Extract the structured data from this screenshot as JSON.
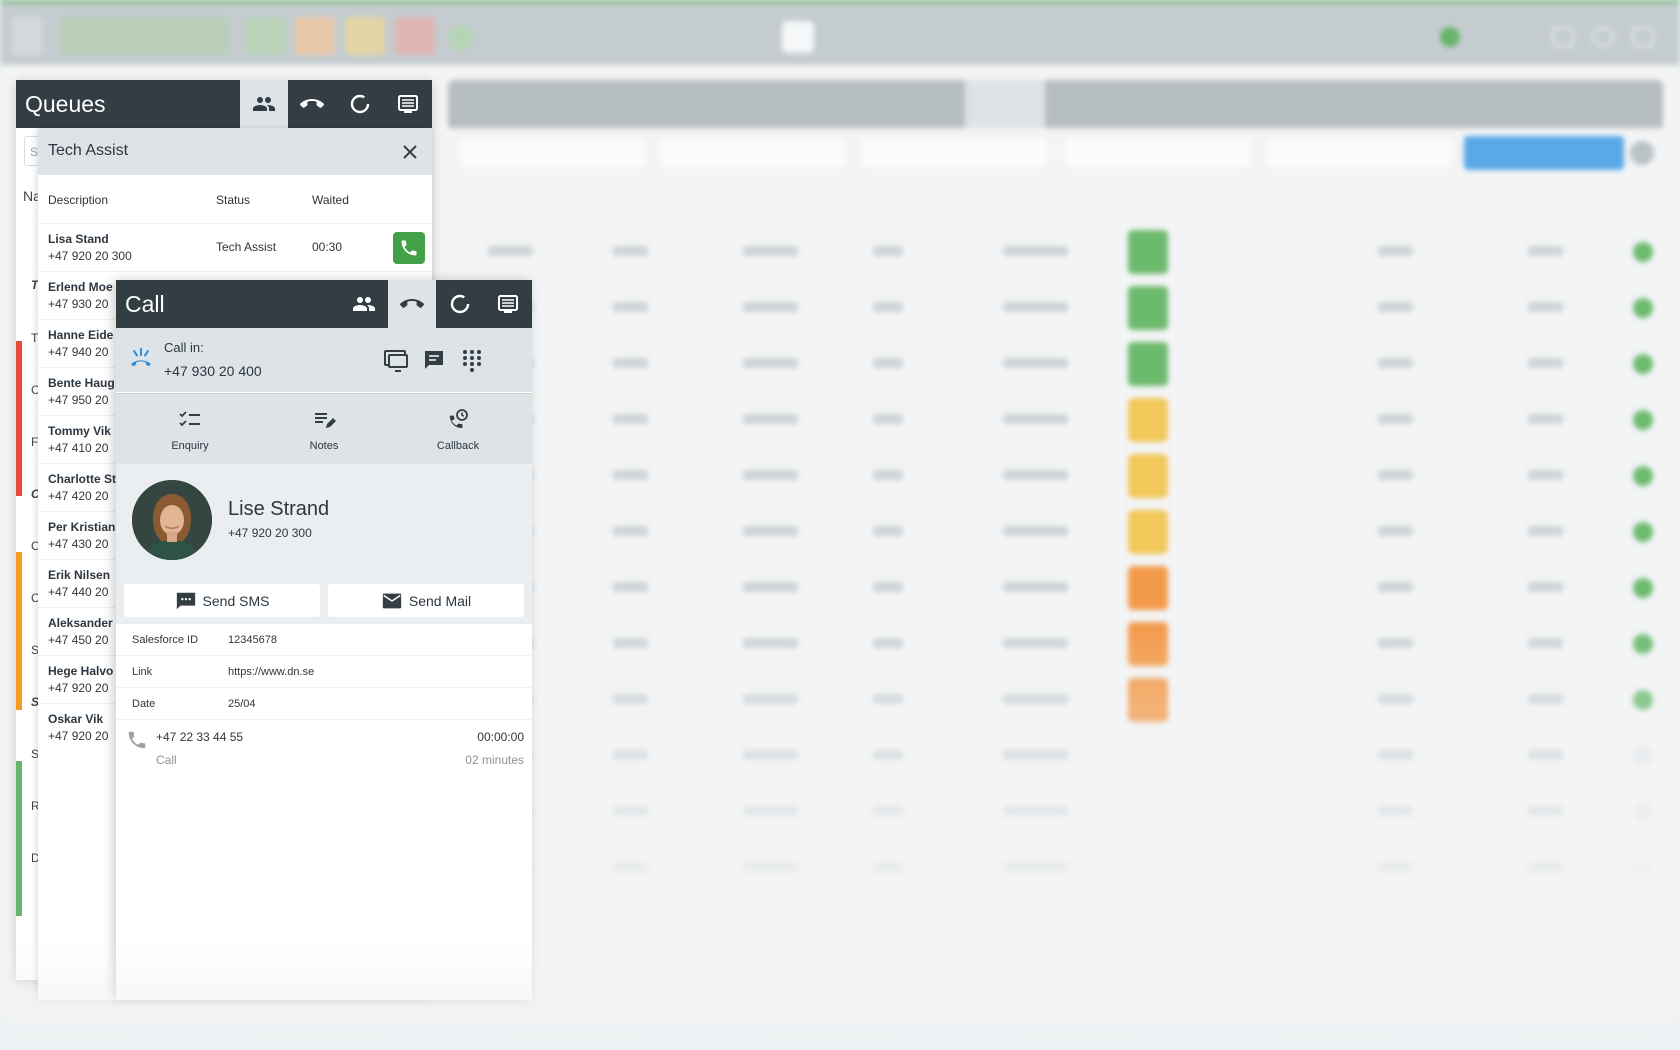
{
  "queues": {
    "title": "Queues",
    "search_placeholder": "S",
    "column_letter": "Na",
    "group_letters": [
      "T",
      "T",
      "C",
      "F",
      "C",
      "C",
      "C",
      "S",
      "S",
      "S",
      "R",
      "D"
    ]
  },
  "tech_assist": {
    "title": "Tech Assist",
    "columns": {
      "description": "Description",
      "status": "Status",
      "waited": "Waited"
    },
    "rows": [
      {
        "name": "Lisa Stand",
        "phone": "+47 920 20 300",
        "status": "Tech Assist",
        "waited": "00:30"
      },
      {
        "name": "Erlend Moe",
        "phone": "+47 930 20"
      },
      {
        "name": "Hanne Eide",
        "phone": "+47 940 20"
      },
      {
        "name": "Bente Haug",
        "phone": "+47 950 20"
      },
      {
        "name": "Tommy Vik",
        "phone": "+47 410 20"
      },
      {
        "name": "Charlotte St",
        "phone": "+47 420 20"
      },
      {
        "name": "Per Kristian",
        "phone": "+47 430 20"
      },
      {
        "name": "Erik Nilsen",
        "phone": "+47 440 20"
      },
      {
        "name": "Aleksander",
        "phone": "+47 450 20"
      },
      {
        "name": "Hege Halvo",
        "phone": "+47 920 20"
      },
      {
        "name": "Oskar Vik",
        "phone": "+47 920 20"
      }
    ]
  },
  "call": {
    "title": "Call",
    "call_in_label": "Call in:",
    "call_in_number": "+47 930 20 400",
    "actions": {
      "enquiry": "Enquiry",
      "notes": "Notes",
      "callback": "Callback"
    },
    "contact": {
      "name": "Lise Strand",
      "phone": "+47 920 20 300"
    },
    "send_sms": "Send SMS",
    "send_mail": "Send Mail",
    "fields": [
      {
        "label": "Salesforce ID",
        "value": "12345678"
      },
      {
        "label": "Link",
        "value": "https://www.dn.se"
      },
      {
        "label": "Date",
        "value": "25/04"
      }
    ],
    "history": {
      "number": "+47 22 33 44 55",
      "type": "Call",
      "time": "00:00:00",
      "duration": "02 minutes"
    }
  },
  "colors": {
    "header_dark": "#333d44",
    "panel_light": "#dde3e7",
    "call_green": "#43a047",
    "accent_blue": "#2e8bd6"
  },
  "icons": [
    "people-icon",
    "phone-hangup-icon",
    "refresh-icon",
    "list-icon",
    "close-icon",
    "phone-icon",
    "incoming-call-icon",
    "screen-icon",
    "chat-icon",
    "dialpad-icon",
    "checklist-icon",
    "notes-icon",
    "callback-icon",
    "sms-icon",
    "mail-icon"
  ]
}
